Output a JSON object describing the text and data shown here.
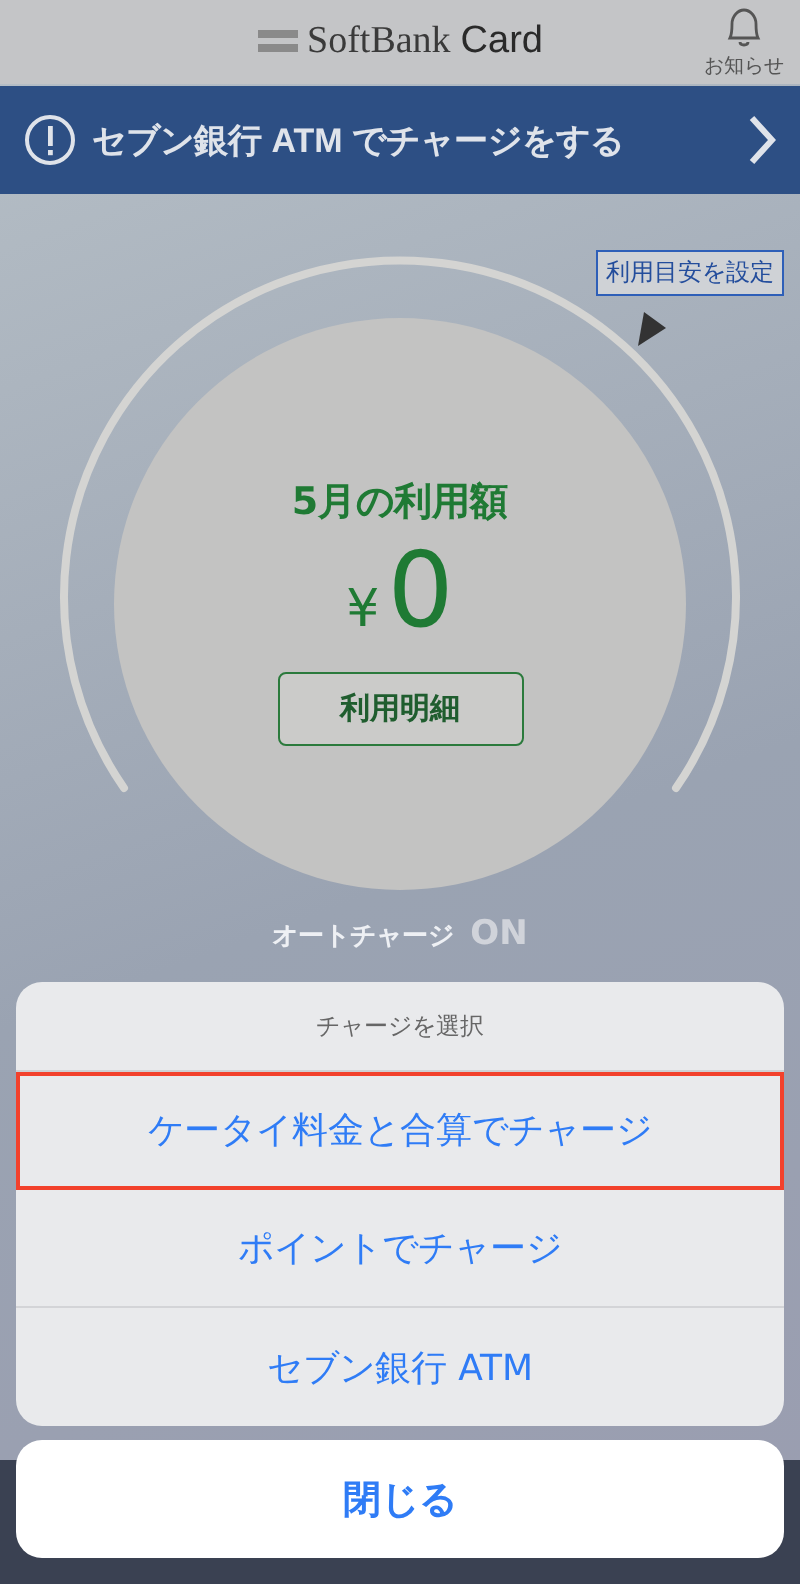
{
  "header": {
    "brand_plain": "SoftBank",
    "brand_bold": "Card",
    "notice_label": "お知らせ"
  },
  "banner": {
    "text": "セブン銀行 ATM でチャージをする"
  },
  "gauge": {
    "limit_button": "利用目安を設定",
    "title": "5月の利用額",
    "currency": "¥",
    "amount": "0",
    "detail_button": "利用明細"
  },
  "auto_charge": {
    "label": "オートチャージ",
    "status": "ON"
  },
  "action_sheet": {
    "title": "チャージを選択",
    "options": [
      {
        "label": "ケータイ料金と合算でチャージ",
        "highlighted": true
      },
      {
        "label": "ポイントでチャージ",
        "highlighted": false
      },
      {
        "label": "セブン銀行 ATM",
        "highlighted": false
      }
    ],
    "cancel": "閉じる"
  }
}
